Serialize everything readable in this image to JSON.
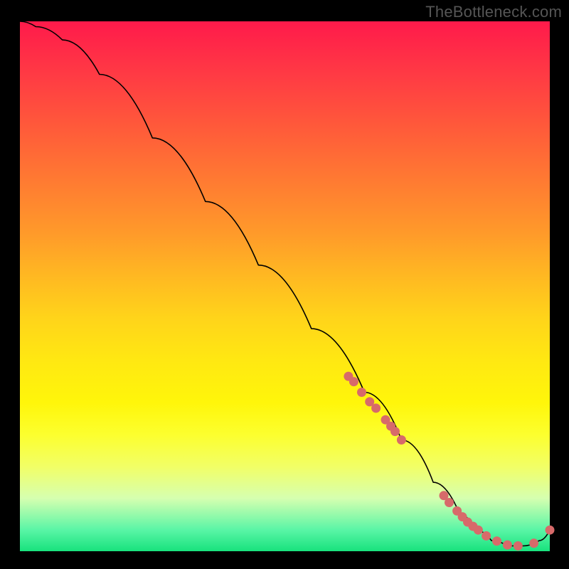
{
  "watermark": "TheBottleneck.com",
  "chart_data": {
    "type": "line",
    "title": "",
    "xlabel": "",
    "ylabel": "",
    "xlim": [
      0,
      100
    ],
    "ylim": [
      0,
      100
    ],
    "grid": false,
    "legend": false,
    "series": [
      {
        "name": "bottleneck-curve",
        "x": [
          0,
          3,
          8,
          15,
          25,
          35,
          45,
          55,
          65,
          72,
          78,
          83,
          86,
          89,
          92,
          95,
          98,
          100
        ],
        "y": [
          100,
          99,
          96.5,
          90,
          78,
          66,
          54,
          42,
          30,
          21,
          13,
          7,
          4,
          2,
          1,
          1,
          2,
          4
        ]
      }
    ],
    "scatter_points": {
      "name": "marked-points",
      "x": [
        62,
        63,
        64.5,
        66,
        67.2,
        69,
        70,
        70.8,
        72,
        80,
        81,
        82.5,
        83.5,
        84.5,
        85.5,
        86.5,
        88,
        90,
        92,
        94,
        97,
        100
      ],
      "y": [
        33,
        32,
        30,
        28.2,
        27,
        24.8,
        23.6,
        22.6,
        21,
        10.5,
        9.2,
        7.6,
        6.5,
        5.5,
        4.7,
        4,
        2.9,
        1.9,
        1.2,
        1,
        1.5,
        4
      ]
    },
    "background_gradient": {
      "top": "#ff1a4b",
      "mid": "#fff60a",
      "bottom": "#18e27d"
    }
  }
}
